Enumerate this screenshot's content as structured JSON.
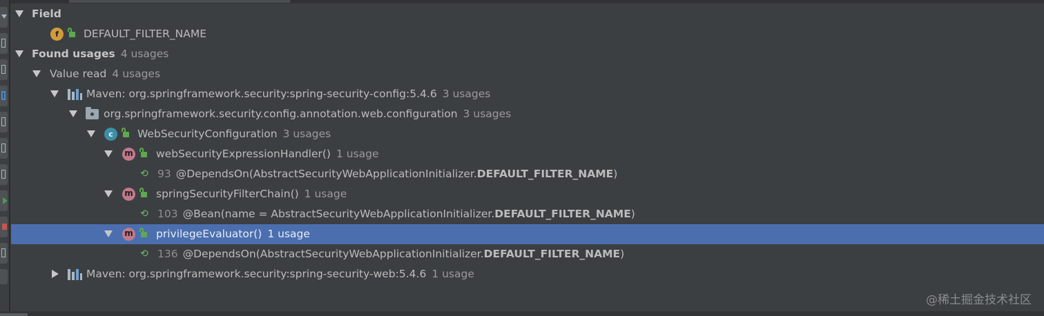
{
  "tree": {
    "field_header": "Field",
    "field_name": "DEFAULT_FILTER_NAME",
    "found_usages": {
      "label": "Found usages",
      "count": "4 usages"
    },
    "value_read": {
      "label": "Value read",
      "count": "4 usages"
    },
    "module_config": {
      "label": "Maven: org.springframework.security:spring-security-config:5.4.6",
      "count": "3 usages"
    },
    "package": {
      "label": "org.springframework.security.config.annotation.web.configuration",
      "count": "3 usages"
    },
    "class": {
      "label": "WebSecurityConfiguration",
      "count": "3 usages"
    },
    "method1": {
      "label": "webSecurityExpressionHandler()",
      "count": "1 usage",
      "line_no": "93",
      "line_pre": "@DependsOn(AbstractSecurityWebApplicationInitializer.",
      "line_bold": "DEFAULT_FILTER_NAME",
      "line_post": ")"
    },
    "method2": {
      "label": "springSecurityFilterChain()",
      "count": "1 usage",
      "line_no": "103",
      "line_pre": "@Bean(name = AbstractSecurityWebApplicationInitializer.",
      "line_bold": "DEFAULT_FILTER_NAME",
      "line_post": ")"
    },
    "method3": {
      "label": "privilegeEvaluator()",
      "count": "1 usage",
      "line_no": "136",
      "line_pre": "@DependsOn(AbstractSecurityWebApplicationInitializer.",
      "line_bold": "DEFAULT_FILTER_NAME",
      "line_post": ")"
    },
    "module_web": {
      "label": "Maven: org.springframework.security:spring-security-web:5.4.6",
      "count": "1 usage"
    }
  },
  "icons": {
    "field": "f",
    "method": "m",
    "class": "c",
    "usage": "⟲"
  },
  "watermark": "@稀土掘金技术社区",
  "colors": {
    "background": "#3c3f41",
    "selection": "#4b6eaf",
    "method_icon": "#c2798c",
    "class_icon": "#3d8fa8",
    "field_icon": "#d19a3d",
    "lock": "#5ea94f"
  }
}
